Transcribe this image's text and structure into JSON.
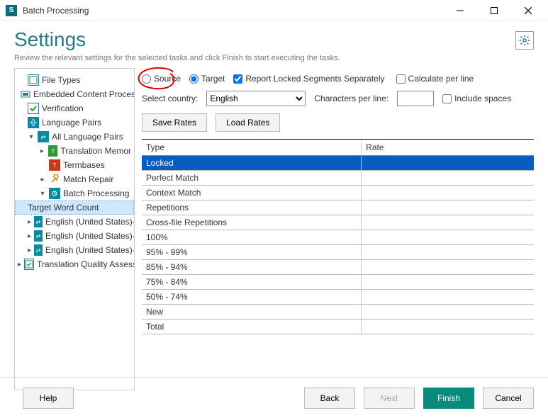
{
  "window": {
    "title": "Batch Processing"
  },
  "header": {
    "title": "Settings",
    "subtitle": "Review the relevant settings for the selected tasks and click Finish to start executing the tasks."
  },
  "tree": {
    "items": [
      {
        "label": "File Types",
        "indent": 0,
        "expander": "",
        "icon": "file"
      },
      {
        "label": "Embedded Content Proces",
        "indent": 0,
        "expander": "",
        "icon": "embed"
      },
      {
        "label": "Verification",
        "indent": 0,
        "expander": "",
        "icon": "verif"
      },
      {
        "label": "Language Pairs",
        "indent": 0,
        "expander": "",
        "icon": "lang"
      },
      {
        "label": "All Language Pairs",
        "indent": 1,
        "expander": "▾",
        "icon": "pairs"
      },
      {
        "label": "Translation Memor",
        "indent": 2,
        "expander": "▸",
        "icon": "mem-green"
      },
      {
        "label": "Termbases",
        "indent": 2,
        "expander": "",
        "icon": "mem-red"
      },
      {
        "label": "Match Repair",
        "indent": 2,
        "expander": "▸",
        "icon": "wrench"
      },
      {
        "label": "Batch Processing",
        "indent": 2,
        "expander": "▾",
        "icon": "batch"
      },
      {
        "label": "Target Word Count",
        "indent": 3,
        "expander": "",
        "icon": "",
        "selected": true
      },
      {
        "label": "English (United States)-",
        "indent": 1,
        "expander": "▸",
        "icon": "pairs"
      },
      {
        "label": "English (United States)-",
        "indent": 1,
        "expander": "▸",
        "icon": "pairs"
      },
      {
        "label": "English (United States)-",
        "indent": 1,
        "expander": "▸",
        "icon": "pairs"
      },
      {
        "label": "Translation Quality Assess",
        "indent": 0,
        "expander": "▸",
        "icon": "qa"
      }
    ]
  },
  "options": {
    "radio": {
      "source": "Source",
      "target": "Target",
      "selected": "target"
    },
    "report_locked": {
      "label": "Report Locked Segments Separately",
      "checked": true
    },
    "calc_per_line": {
      "label": "Calculate per line",
      "checked": false
    },
    "select_country_label": "Select country:",
    "country": "English",
    "chars_per_line_label": "Characters per line:",
    "chars_per_line_value": "",
    "include_spaces": {
      "label": "Include spaces",
      "checked": false
    },
    "save_rates": "Save Rates",
    "load_rates": "Load Rates"
  },
  "table": {
    "headers": {
      "type": "Type",
      "rate": "Rate"
    },
    "rows": [
      {
        "type": "Locked",
        "rate": "",
        "selected": true
      },
      {
        "type": "Perfect Match",
        "rate": ""
      },
      {
        "type": "Context Match",
        "rate": ""
      },
      {
        "type": "Repetitions",
        "rate": ""
      },
      {
        "type": "Cross-file Repetitions",
        "rate": ""
      },
      {
        "type": "100%",
        "rate": ""
      },
      {
        "type": "95% - 99%",
        "rate": ""
      },
      {
        "type": "85% - 94%",
        "rate": ""
      },
      {
        "type": "75% - 84%",
        "rate": ""
      },
      {
        "type": "50% - 74%",
        "rate": ""
      },
      {
        "type": "New",
        "rate": ""
      },
      {
        "type": "Total",
        "rate": ""
      }
    ]
  },
  "footer": {
    "help": "Help",
    "back": "Back",
    "next": "Next",
    "finish": "Finish",
    "cancel": "Cancel"
  }
}
